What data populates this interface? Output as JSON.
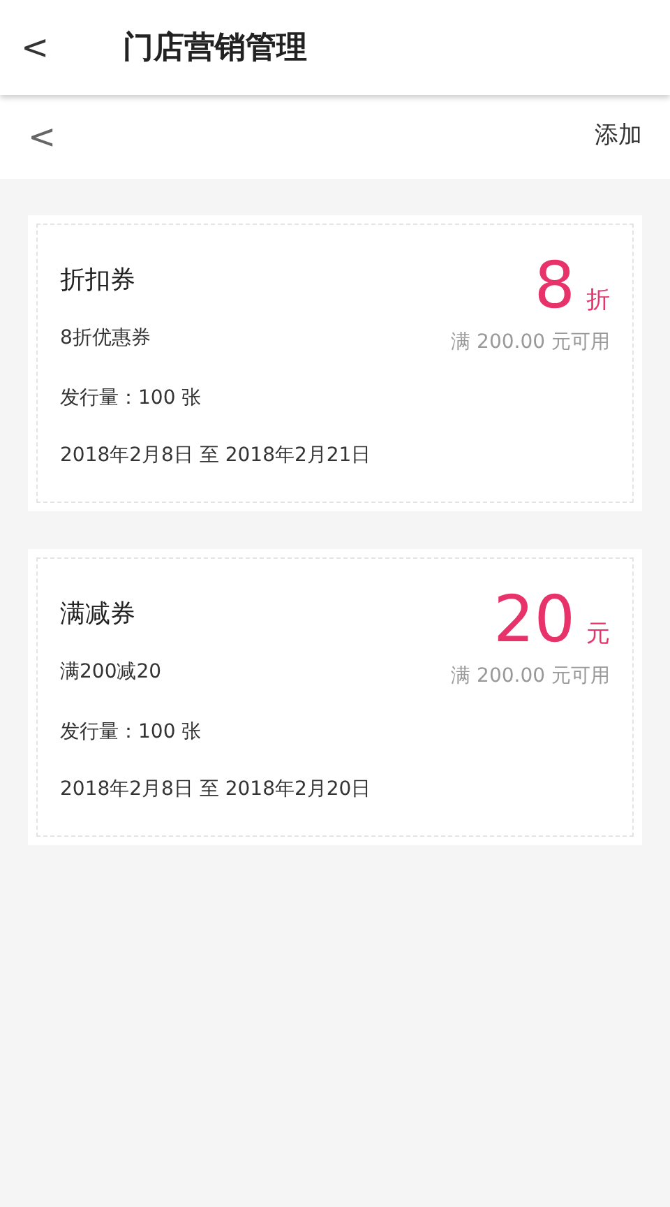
{
  "app_bar": {
    "back": "<",
    "title": "门店营销管理"
  },
  "toolbar": {
    "back": "<",
    "action": "添加"
  },
  "coupons": [
    {
      "name": "折扣券",
      "desc": "8折优惠券",
      "issued": "发行量：100 张",
      "period": "2018年2月8日 至 2018年2月21日",
      "amount": "8",
      "unit": "折",
      "condition": "满 200.00 元可用"
    },
    {
      "name": "满减券",
      "desc": "满200减20",
      "issued": "发行量：100 张",
      "period": "2018年2月8日 至 2018年2月20日",
      "amount": "20",
      "unit": "元",
      "condition": "满 200.00 元可用"
    }
  ]
}
